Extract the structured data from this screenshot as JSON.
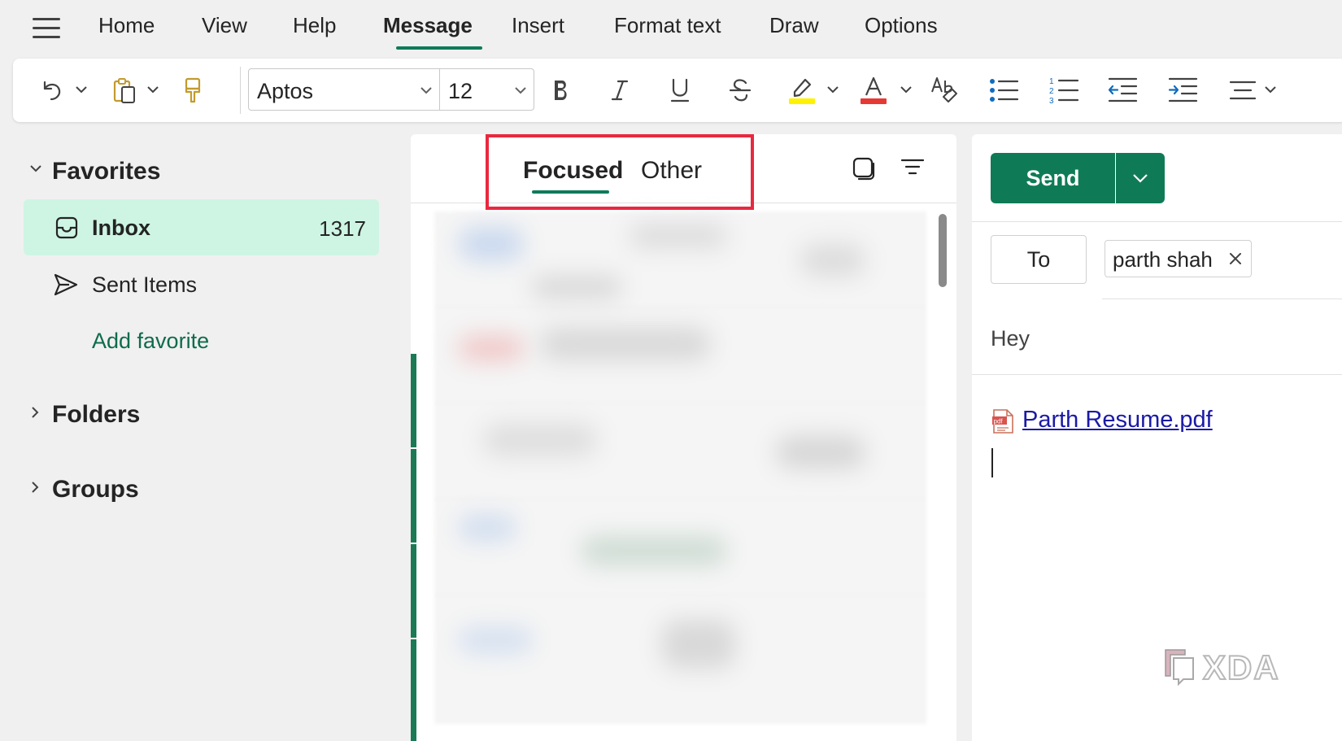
{
  "menu": {
    "tabs": [
      "Home",
      "View",
      "Help",
      "Message",
      "Insert",
      "Format text",
      "Draw",
      "Options"
    ],
    "active_tab": "Message"
  },
  "ribbon": {
    "font_name": "Aptos",
    "font_size": "12",
    "highlight_color": "#fff200",
    "font_color": "#e53935",
    "icons": [
      "undo-icon",
      "paste-icon",
      "format-painter-icon",
      "bold-icon",
      "italic-icon",
      "underline-icon",
      "strikethrough-icon",
      "highlight-icon",
      "font-color-icon",
      "styles-icon",
      "bullets-icon",
      "numbering-icon",
      "decrease-indent-icon",
      "increase-indent-icon",
      "align-icon"
    ]
  },
  "nav": {
    "favorites_label": "Favorites",
    "inbox_label": "Inbox",
    "inbox_count": "1317",
    "sent_label": "Sent Items",
    "add_favorite_label": "Add favorite",
    "folders_label": "Folders",
    "groups_label": "Groups"
  },
  "message_list": {
    "tab_focused": "Focused",
    "tab_other": "Other",
    "active_tab": "Focused",
    "highlight_color": "#e8293f"
  },
  "compose": {
    "send_label": "Send",
    "to_label": "To",
    "recipient": "parth shah",
    "subject": "Hey",
    "attachment_name": "Parth Resume.pdf"
  },
  "watermark": {
    "text": "XDA"
  },
  "colors": {
    "accent": "#0f7b56",
    "selected_bg": "#cef5e4",
    "link": "#1a1aa6"
  }
}
